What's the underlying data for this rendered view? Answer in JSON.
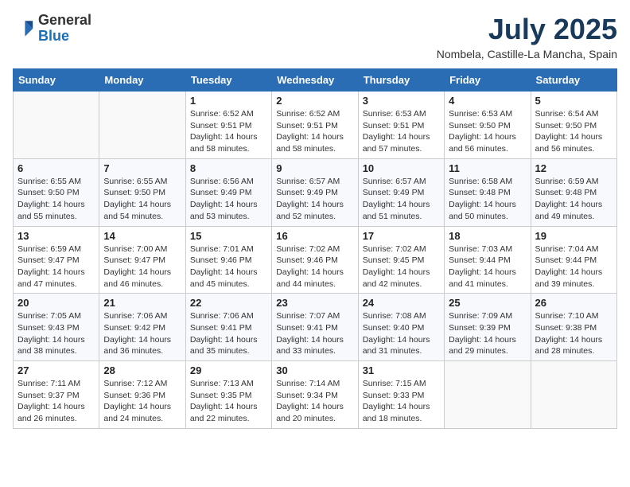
{
  "header": {
    "logo_general": "General",
    "logo_blue": "Blue",
    "title": "July 2025",
    "subtitle": "Nombela, Castille-La Mancha, Spain"
  },
  "days_of_week": [
    "Sunday",
    "Monday",
    "Tuesday",
    "Wednesday",
    "Thursday",
    "Friday",
    "Saturday"
  ],
  "weeks": [
    [
      {
        "num": "",
        "sunrise": "",
        "sunset": "",
        "daylight": ""
      },
      {
        "num": "",
        "sunrise": "",
        "sunset": "",
        "daylight": ""
      },
      {
        "num": "1",
        "sunrise": "Sunrise: 6:52 AM",
        "sunset": "Sunset: 9:51 PM",
        "daylight": "Daylight: 14 hours and 58 minutes."
      },
      {
        "num": "2",
        "sunrise": "Sunrise: 6:52 AM",
        "sunset": "Sunset: 9:51 PM",
        "daylight": "Daylight: 14 hours and 58 minutes."
      },
      {
        "num": "3",
        "sunrise": "Sunrise: 6:53 AM",
        "sunset": "Sunset: 9:51 PM",
        "daylight": "Daylight: 14 hours and 57 minutes."
      },
      {
        "num": "4",
        "sunrise": "Sunrise: 6:53 AM",
        "sunset": "Sunset: 9:50 PM",
        "daylight": "Daylight: 14 hours and 56 minutes."
      },
      {
        "num": "5",
        "sunrise": "Sunrise: 6:54 AM",
        "sunset": "Sunset: 9:50 PM",
        "daylight": "Daylight: 14 hours and 56 minutes."
      }
    ],
    [
      {
        "num": "6",
        "sunrise": "Sunrise: 6:55 AM",
        "sunset": "Sunset: 9:50 PM",
        "daylight": "Daylight: 14 hours and 55 minutes."
      },
      {
        "num": "7",
        "sunrise": "Sunrise: 6:55 AM",
        "sunset": "Sunset: 9:50 PM",
        "daylight": "Daylight: 14 hours and 54 minutes."
      },
      {
        "num": "8",
        "sunrise": "Sunrise: 6:56 AM",
        "sunset": "Sunset: 9:49 PM",
        "daylight": "Daylight: 14 hours and 53 minutes."
      },
      {
        "num": "9",
        "sunrise": "Sunrise: 6:57 AM",
        "sunset": "Sunset: 9:49 PM",
        "daylight": "Daylight: 14 hours and 52 minutes."
      },
      {
        "num": "10",
        "sunrise": "Sunrise: 6:57 AM",
        "sunset": "Sunset: 9:49 PM",
        "daylight": "Daylight: 14 hours and 51 minutes."
      },
      {
        "num": "11",
        "sunrise": "Sunrise: 6:58 AM",
        "sunset": "Sunset: 9:48 PM",
        "daylight": "Daylight: 14 hours and 50 minutes."
      },
      {
        "num": "12",
        "sunrise": "Sunrise: 6:59 AM",
        "sunset": "Sunset: 9:48 PM",
        "daylight": "Daylight: 14 hours and 49 minutes."
      }
    ],
    [
      {
        "num": "13",
        "sunrise": "Sunrise: 6:59 AM",
        "sunset": "Sunset: 9:47 PM",
        "daylight": "Daylight: 14 hours and 47 minutes."
      },
      {
        "num": "14",
        "sunrise": "Sunrise: 7:00 AM",
        "sunset": "Sunset: 9:47 PM",
        "daylight": "Daylight: 14 hours and 46 minutes."
      },
      {
        "num": "15",
        "sunrise": "Sunrise: 7:01 AM",
        "sunset": "Sunset: 9:46 PM",
        "daylight": "Daylight: 14 hours and 45 minutes."
      },
      {
        "num": "16",
        "sunrise": "Sunrise: 7:02 AM",
        "sunset": "Sunset: 9:46 PM",
        "daylight": "Daylight: 14 hours and 44 minutes."
      },
      {
        "num": "17",
        "sunrise": "Sunrise: 7:02 AM",
        "sunset": "Sunset: 9:45 PM",
        "daylight": "Daylight: 14 hours and 42 minutes."
      },
      {
        "num": "18",
        "sunrise": "Sunrise: 7:03 AM",
        "sunset": "Sunset: 9:44 PM",
        "daylight": "Daylight: 14 hours and 41 minutes."
      },
      {
        "num": "19",
        "sunrise": "Sunrise: 7:04 AM",
        "sunset": "Sunset: 9:44 PM",
        "daylight": "Daylight: 14 hours and 39 minutes."
      }
    ],
    [
      {
        "num": "20",
        "sunrise": "Sunrise: 7:05 AM",
        "sunset": "Sunset: 9:43 PM",
        "daylight": "Daylight: 14 hours and 38 minutes."
      },
      {
        "num": "21",
        "sunrise": "Sunrise: 7:06 AM",
        "sunset": "Sunset: 9:42 PM",
        "daylight": "Daylight: 14 hours and 36 minutes."
      },
      {
        "num": "22",
        "sunrise": "Sunrise: 7:06 AM",
        "sunset": "Sunset: 9:41 PM",
        "daylight": "Daylight: 14 hours and 35 minutes."
      },
      {
        "num": "23",
        "sunrise": "Sunrise: 7:07 AM",
        "sunset": "Sunset: 9:41 PM",
        "daylight": "Daylight: 14 hours and 33 minutes."
      },
      {
        "num": "24",
        "sunrise": "Sunrise: 7:08 AM",
        "sunset": "Sunset: 9:40 PM",
        "daylight": "Daylight: 14 hours and 31 minutes."
      },
      {
        "num": "25",
        "sunrise": "Sunrise: 7:09 AM",
        "sunset": "Sunset: 9:39 PM",
        "daylight": "Daylight: 14 hours and 29 minutes."
      },
      {
        "num": "26",
        "sunrise": "Sunrise: 7:10 AM",
        "sunset": "Sunset: 9:38 PM",
        "daylight": "Daylight: 14 hours and 28 minutes."
      }
    ],
    [
      {
        "num": "27",
        "sunrise": "Sunrise: 7:11 AM",
        "sunset": "Sunset: 9:37 PM",
        "daylight": "Daylight: 14 hours and 26 minutes."
      },
      {
        "num": "28",
        "sunrise": "Sunrise: 7:12 AM",
        "sunset": "Sunset: 9:36 PM",
        "daylight": "Daylight: 14 hours and 24 minutes."
      },
      {
        "num": "29",
        "sunrise": "Sunrise: 7:13 AM",
        "sunset": "Sunset: 9:35 PM",
        "daylight": "Daylight: 14 hours and 22 minutes."
      },
      {
        "num": "30",
        "sunrise": "Sunrise: 7:14 AM",
        "sunset": "Sunset: 9:34 PM",
        "daylight": "Daylight: 14 hours and 20 minutes."
      },
      {
        "num": "31",
        "sunrise": "Sunrise: 7:15 AM",
        "sunset": "Sunset: 9:33 PM",
        "daylight": "Daylight: 14 hours and 18 minutes."
      },
      {
        "num": "",
        "sunrise": "",
        "sunset": "",
        "daylight": ""
      },
      {
        "num": "",
        "sunrise": "",
        "sunset": "",
        "daylight": ""
      }
    ]
  ]
}
